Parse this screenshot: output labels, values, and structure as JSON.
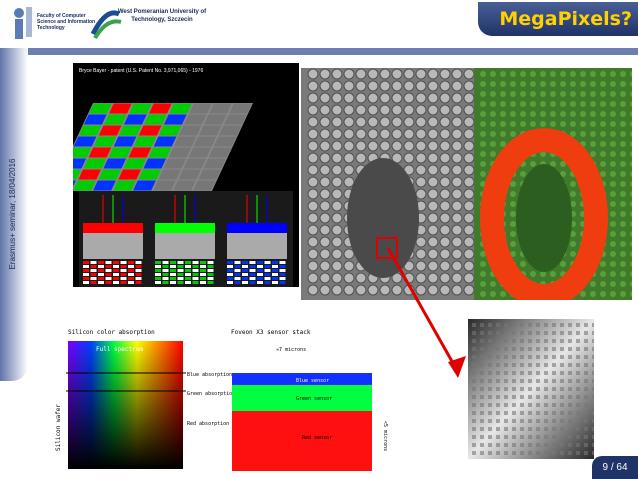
{
  "header": {
    "faculty_text": "Faculty of Computer Science and Information Technology",
    "university_text": "West Pomeranian University of Technology, Szczecin",
    "title": "MegaPixels?"
  },
  "sidebar": {
    "text": "Erasmus+ seminar, 18/04/2016"
  },
  "slide": {
    "bayer_caption": "Bryce Bayer - patent (U.S. Patent No. 3,971,065) - 1976",
    "silicon_title": "Silicon color absorption",
    "full_spectrum": "Full spectrum",
    "blue_abs": "Blue absorption",
    "green_abs": "Green absorption",
    "red_abs": "Red absorption",
    "wafer": "Silicon wafer",
    "foveon_title": "Foveon X3 sensor stack",
    "microns7": "≈7 microns",
    "microns5": "<5 microns",
    "blue_sensor": "Blue sensor",
    "green_sensor": "Green sensor",
    "red_sensor": "Red sensor"
  },
  "pager": {
    "label": "9 / 64"
  },
  "colors": {
    "title": "#ffd100",
    "navy": "#1f3367",
    "red_arrow": "#e00000"
  }
}
